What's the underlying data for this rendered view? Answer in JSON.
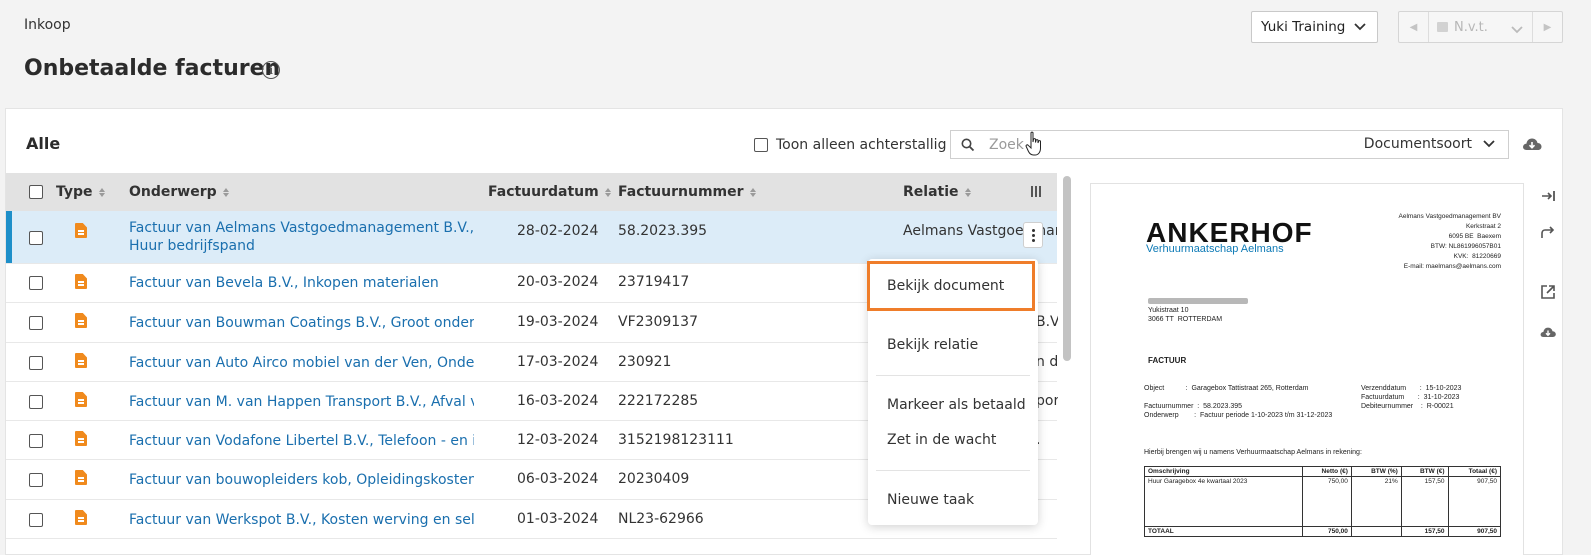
{
  "breadcrumb": "Inkoop",
  "title": "Onbetaalde facturen",
  "company": "Yuki Training",
  "period": "N.v.t.",
  "filter_title": "Alle",
  "overdue_label": "Toon alleen achterstallig",
  "search": {
    "placeholder": "Zoek",
    "doctype": "Documentsoort"
  },
  "columns": {
    "type": "Type",
    "subject": "Onderwerp",
    "date": "Factuurdatum",
    "number": "Factuurnummer",
    "relation": "Relatie"
  },
  "rows": [
    {
      "subject": "Factuur van Aelmans Vastgoedmanagement B.V., Huur bedrijfspand",
      "subject_line1": "Factuur van Aelmans Vastgoedmanagement B.V.,",
      "subject_line2": "Huur bedrijfspand",
      "date": "28-02-2024",
      "number": "58.2023.395",
      "relation": "Aelmans Vastgoedmanag"
    },
    {
      "subject": "Factuur van Bevela B.V., Inkopen materialen",
      "date": "20-03-2024",
      "number": "23719417",
      "relation": ""
    },
    {
      "subject": "Factuur van Bouwman Coatings B.V., Groot onderh...",
      "date": "19-03-2024",
      "number": "VF2309137",
      "relation": "B.V."
    },
    {
      "subject": "Factuur van Auto Airco mobiel van der Ven, Onderh...",
      "date": "17-03-2024",
      "number": "230921",
      "relation": "n de"
    },
    {
      "subject": "Factuur van M. van Happen Transport B.V., Afval ve...",
      "date": "16-03-2024",
      "number": "222172285",
      "relation": "port"
    },
    {
      "subject": "Factuur van Vodafone Libertel B.V., Telefoon - en in...",
      "date": "12-03-2024",
      "number": "3152198123111",
      "relation": "."
    },
    {
      "subject": "Factuur van bouwopleiders kob, Opleidingskosten",
      "date": "06-03-2024",
      "number": "20230409",
      "relation": ""
    },
    {
      "subject": "Factuur van Werkspot B.V., Kosten werving en sele...",
      "date": "01-03-2024",
      "number": "NL23-62966",
      "relation": ""
    }
  ],
  "menu": {
    "view_document": "Bekijk document",
    "view_relation": "Bekijk relatie",
    "mark_paid": "Markeer als betaald",
    "put_on_hold": "Zet in de wacht",
    "new_task": "Nieuwe taak"
  },
  "preview": {
    "logo": "ANKERHOF",
    "logo_sub": "Verhuurmaatschap Aelmans",
    "sender_address": "Aelmans Vastgoedmanagement BV\nKerkstraat 2\n6095 BE  Baexem\nBTW: NL861996057B01\nKVK:  81220669\nE-mail: maelmans@aelmans.com",
    "recipient_address": "Yukistraat 10\n3066 TT  ROTTERDAM",
    "doc_title": "FACTUUR",
    "meta_left": "Object           :  Garagebox Tattistraat 265, Rotterdam\n\nFactuurnummer  :  58.2023.395\nOnderwerp        :  Factuur periode 1-10-2023 t/m 31-12-2023",
    "meta_right": "Verzenddatum       :  15-10-2023\nFactuurdatum       :  31-10-2023\nDebiteurnummer    :  R-00021",
    "intro": "Hierbij brengen wij u namens Verhuurmaatschap Aelmans in rekening:",
    "table_headers": [
      "Omschrijving",
      "Netto (€)",
      "BTW (%)",
      "BTW (€)",
      "Totaal (€)"
    ],
    "table_row": [
      "Huur Garagebox 4e kwartaal 2023",
      "750,00",
      "21%",
      "157,50",
      "907,50"
    ],
    "table_total": [
      "TOTAAL",
      "750,00",
      "",
      "157,50",
      "907,50"
    ]
  },
  "colors": {
    "link": "#1a6fae",
    "accent": "#1e8fc9",
    "highlight": "#ef7d2a",
    "doc_icon": "#f08a1d"
  },
  "icons": [
    "info-icon",
    "chevron-down-icon",
    "search-icon",
    "cloud-download-icon",
    "column-select-icon",
    "document-icon",
    "kebab-icon",
    "collapse-icon",
    "redirect-icon",
    "external-link-icon"
  ]
}
